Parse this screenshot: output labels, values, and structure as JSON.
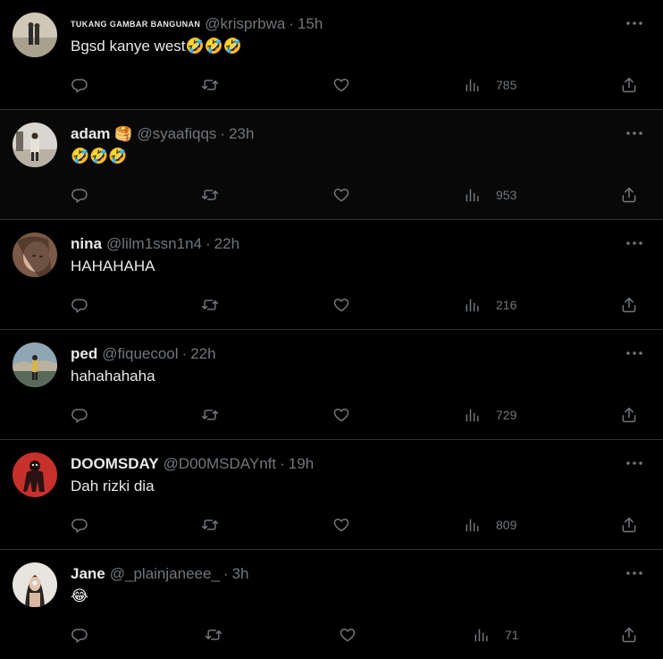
{
  "colors": {
    "background": "#000000",
    "text": "#e7e9ea",
    "muted": "#71767b",
    "divider": "#2f3336"
  },
  "icons": {
    "more": "more-dots-icon",
    "reply": "reply-icon",
    "retweet": "retweet-icon",
    "like": "heart-icon",
    "views": "views-chart-icon",
    "share": "share-icon"
  },
  "tweets": [
    {
      "name": "TUKANG GAMBAR BANGUNAN",
      "name_emoji": "",
      "handle": "@krisprbwa",
      "separator": "·",
      "time": "15h",
      "text": "Bgsd kanye west🤣🤣🤣",
      "views": "785"
    },
    {
      "name": "adam",
      "name_emoji": "🥞",
      "handle": "@syaafiqqs",
      "separator": "·",
      "time": "23h",
      "text": "🤣🤣🤣",
      "views": "953"
    },
    {
      "name": "nina",
      "name_emoji": "",
      "handle": "@lilm1ssn1n4",
      "separator": "·",
      "time": "22h",
      "text": "HAHAHAHA",
      "views": "216"
    },
    {
      "name": "ped",
      "name_emoji": "",
      "handle": "@fiquecool",
      "separator": "·",
      "time": "22h",
      "text": "hahahahaha",
      "views": "729"
    },
    {
      "name": "DOOMSDAY",
      "name_emoji": "",
      "handle": "@D00MSDAYnft",
      "separator": "·",
      "time": "19h",
      "text": "Dah rizki dia",
      "views": "809"
    },
    {
      "name": "Jane",
      "name_emoji": "",
      "handle": "@_plainjaneee_",
      "separator": "·",
      "time": "3h",
      "text": "😂",
      "views": "71"
    }
  ]
}
